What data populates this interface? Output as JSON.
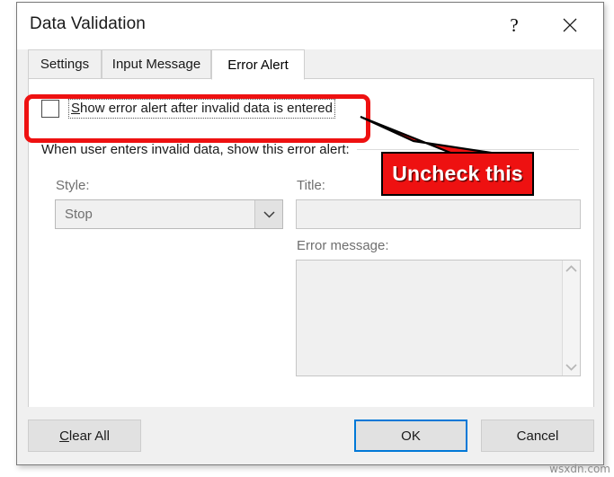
{
  "window": {
    "title": "Data Validation",
    "help_button": "?",
    "close_button": "✕"
  },
  "tabs": [
    {
      "label": "Settings",
      "active": false
    },
    {
      "label": "Input Message",
      "active": false
    },
    {
      "label": "Error Alert",
      "active": true
    }
  ],
  "page": {
    "checkbox": {
      "label_accel": "S",
      "label_rest": "how error alert after invalid data is entered",
      "checked": false
    },
    "group_label": "When user enters invalid data, show this error alert:",
    "style": {
      "label": "Style:",
      "value": "Stop",
      "disabled": true
    },
    "title_field": {
      "label": "Title:",
      "value": "",
      "disabled": true
    },
    "error_message_field": {
      "label": "Error message:",
      "value": "",
      "disabled": true
    }
  },
  "buttons": {
    "clear_all_accel": "C",
    "clear_all_rest": "lear All",
    "ok": "OK",
    "cancel": "Cancel"
  },
  "annotation": {
    "callout_text": "Uncheck this",
    "highlight_color": "#ee1111",
    "callout_bg": "#ee1111",
    "callout_fg": "#ffffff"
  },
  "watermark": "wsxdn.com"
}
